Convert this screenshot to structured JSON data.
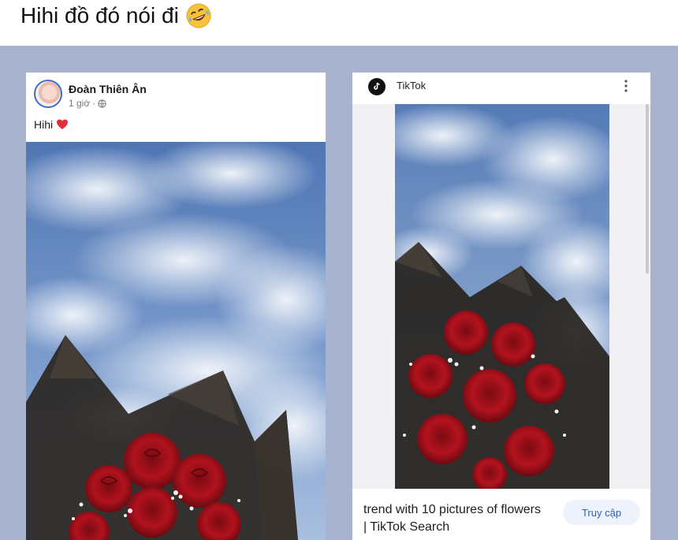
{
  "caption": {
    "text": "Hihi đồ đó nói đi",
    "emoji": "rolling-on-floor-laughing-emoji"
  },
  "facebook_post": {
    "author": "Đoàn Thiên Ân",
    "time": "1 giờ",
    "separator": "·",
    "privacy_icon": "globe-icon",
    "text": "Hihi",
    "text_emoji": "red-heart-icon"
  },
  "tiktok_card": {
    "source": "TikTok",
    "menu_icon": "kebab-menu-icon",
    "title": "trend with 10 pictures of flowers | TikTok Search",
    "button_label": "Truy cập"
  },
  "colors": {
    "collage_background": "#aab3cd",
    "link_blue": "#2a63c6",
    "heart_red": "#e0303a"
  }
}
